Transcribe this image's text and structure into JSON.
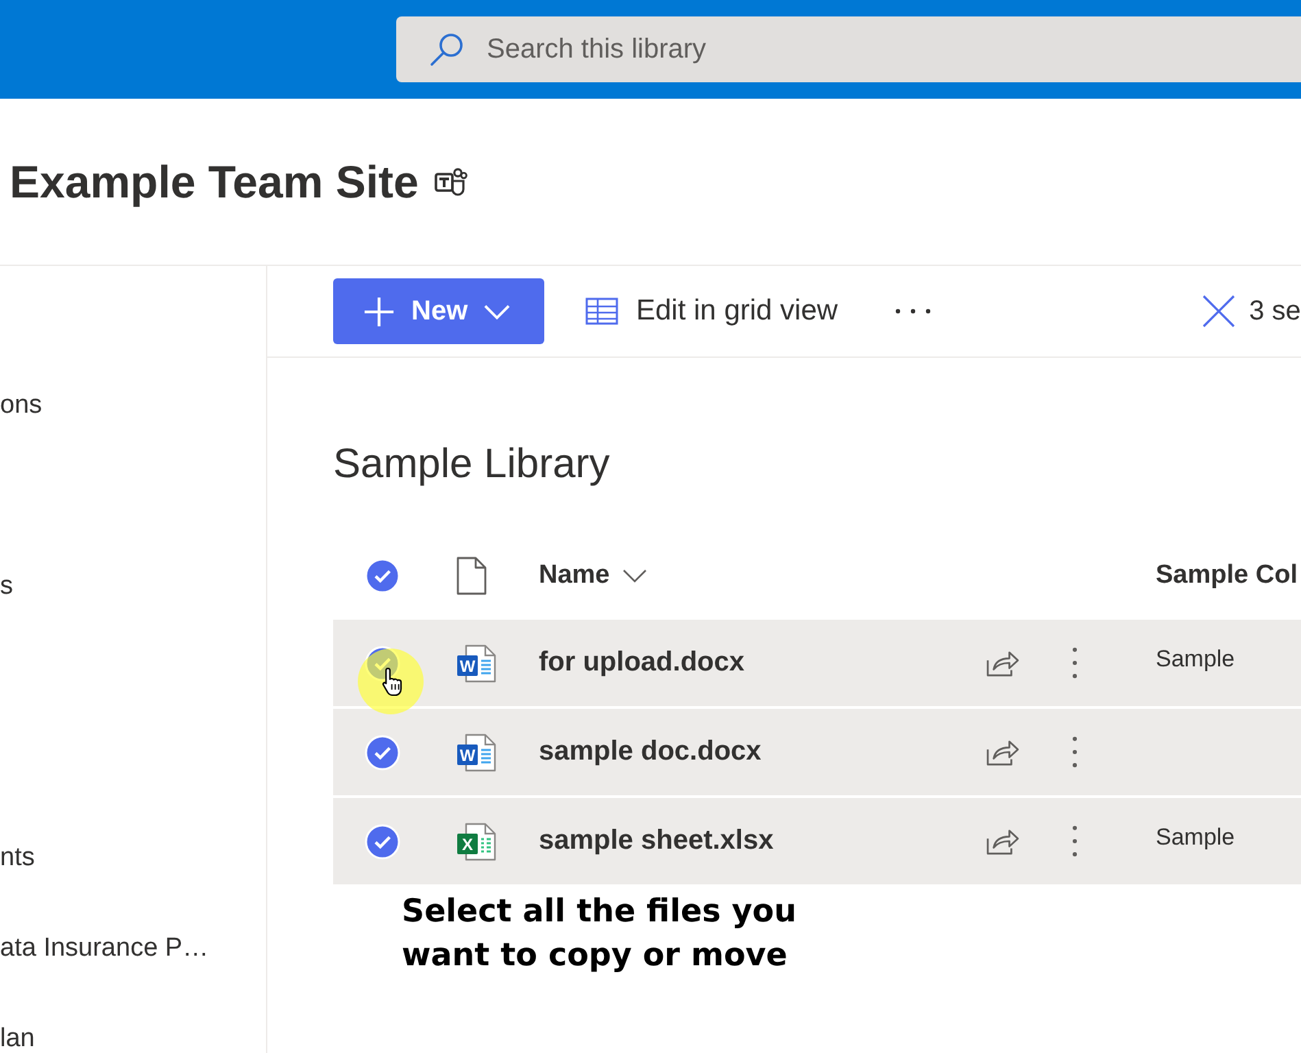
{
  "top_bar": {
    "search": {
      "placeholder": "Search this library"
    }
  },
  "site": {
    "title": "Example Team Site"
  },
  "sidebar": {
    "items": [
      {
        "label": "ons"
      },
      {
        "label": "s"
      },
      {
        "label": "nts"
      },
      {
        "label": "ata Insurance P…"
      },
      {
        "label": "lan"
      }
    ]
  },
  "command_bar": {
    "new_button": {
      "label": "New"
    },
    "edit_grid": {
      "label": "Edit in grid view"
    },
    "selection": {
      "label": "3 se"
    }
  },
  "library": {
    "title": "Sample Library",
    "select_all": {
      "selected": true
    },
    "columns": [
      {
        "kind": "name",
        "label": "Name"
      },
      {
        "kind": "text",
        "label": "Sample Col"
      }
    ],
    "rows": [
      {
        "name": "for upload.docx",
        "file_icon": {
          "kind": "word",
          "letter": "W"
        },
        "selected": true,
        "column_4": "Sample"
      },
      {
        "name": "sample doc.docx",
        "file_icon": {
          "kind": "word",
          "letter": "W"
        },
        "selected": true
      },
      {
        "name": "sample sheet.xlsx",
        "file_icon": {
          "kind": "excel",
          "letter": "X"
        },
        "selected": true,
        "column_4": "Sample"
      }
    ]
  },
  "caption": "Select all the files you want to copy or move"
}
